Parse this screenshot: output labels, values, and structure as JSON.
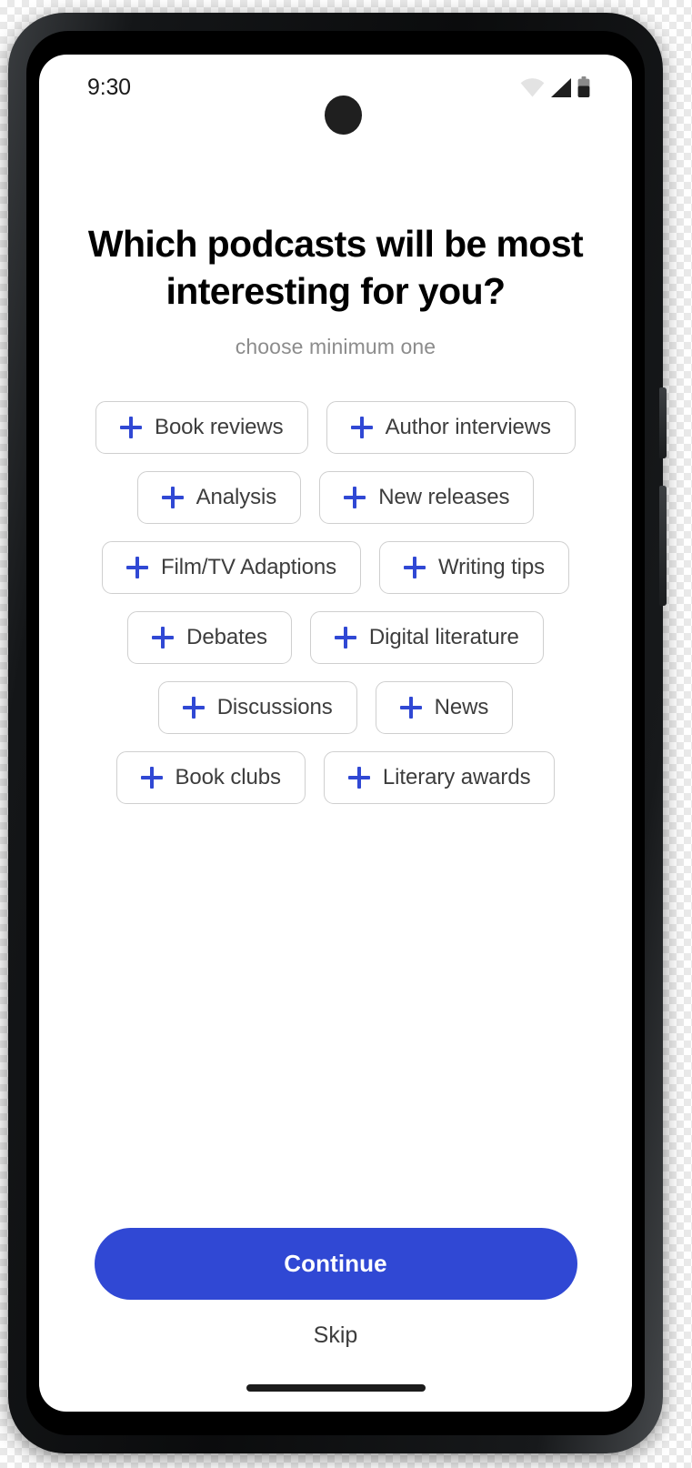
{
  "status_bar": {
    "time": "9:30",
    "icons": [
      "wifi-icon",
      "cellular-signal-icon",
      "battery-icon"
    ]
  },
  "screen": {
    "headline": "Which podcasts will be most interesting for you?",
    "subtitle": "choose minimum one"
  },
  "chips": {
    "icon": "plus-icon",
    "rows": [
      [
        {
          "label": "Book reviews"
        },
        {
          "label": "Author interviews"
        }
      ],
      [
        {
          "label": "Analysis"
        },
        {
          "label": "New releases"
        }
      ],
      [
        {
          "label": "Film/TV Adaptions"
        },
        {
          "label": "Writing tips"
        }
      ],
      [
        {
          "label": "Debates"
        },
        {
          "label": "Digital literature"
        }
      ],
      [
        {
          "label": "Discussions"
        },
        {
          "label": "News"
        }
      ],
      [
        {
          "label": "Book clubs"
        },
        {
          "label": "Literary awards"
        }
      ]
    ]
  },
  "actions": {
    "continue_label": "Continue",
    "skip_label": "Skip"
  },
  "colors": {
    "accent": "#3048d4",
    "chip_border": "#cfcfcf",
    "chip_text": "#3d3d3d",
    "subtitle_text": "#8c8c8c",
    "headline_text": "#000000",
    "screen_bg": "#ffffff",
    "device_frame": "#0b0c0d"
  }
}
